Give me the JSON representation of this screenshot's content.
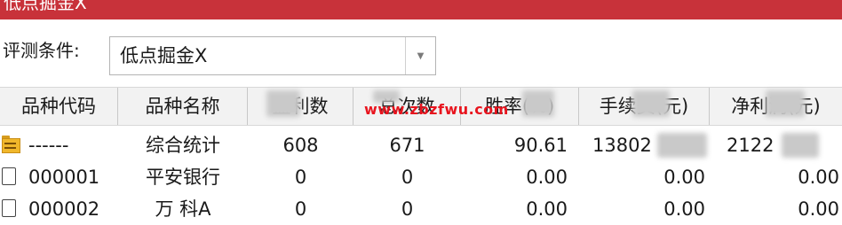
{
  "window": {
    "title": "低点掘金X"
  },
  "filter": {
    "label": "评测条件:",
    "value": "低点掘金X"
  },
  "colors": {
    "titlebar": "#c8323a",
    "watermark": "#e8141e"
  },
  "table": {
    "columns": [
      "品种代码",
      "品种名称",
      "盈利数",
      "总次数",
      "胜率(%)",
      "手续费(元)",
      "净利润(元)"
    ],
    "rows": [
      {
        "icon": "folder-icon",
        "code": "------",
        "name": "综合统计",
        "wins": "608",
        "total": "671",
        "rate": "90.61",
        "fee": "13802",
        "profit": "2122"
      },
      {
        "icon": "document-icon",
        "code": "000001",
        "name": "平安银行",
        "wins": "0",
        "total": "0",
        "rate": "0.00",
        "fee": "0.00",
        "profit": "0.00"
      },
      {
        "icon": "document-icon",
        "code": "000002",
        "name": "万 科A",
        "wins": "0",
        "total": "0",
        "rate": "0.00",
        "fee": "0.00",
        "profit": "0.00"
      }
    ]
  },
  "watermark": "www.zbzfwu.com"
}
